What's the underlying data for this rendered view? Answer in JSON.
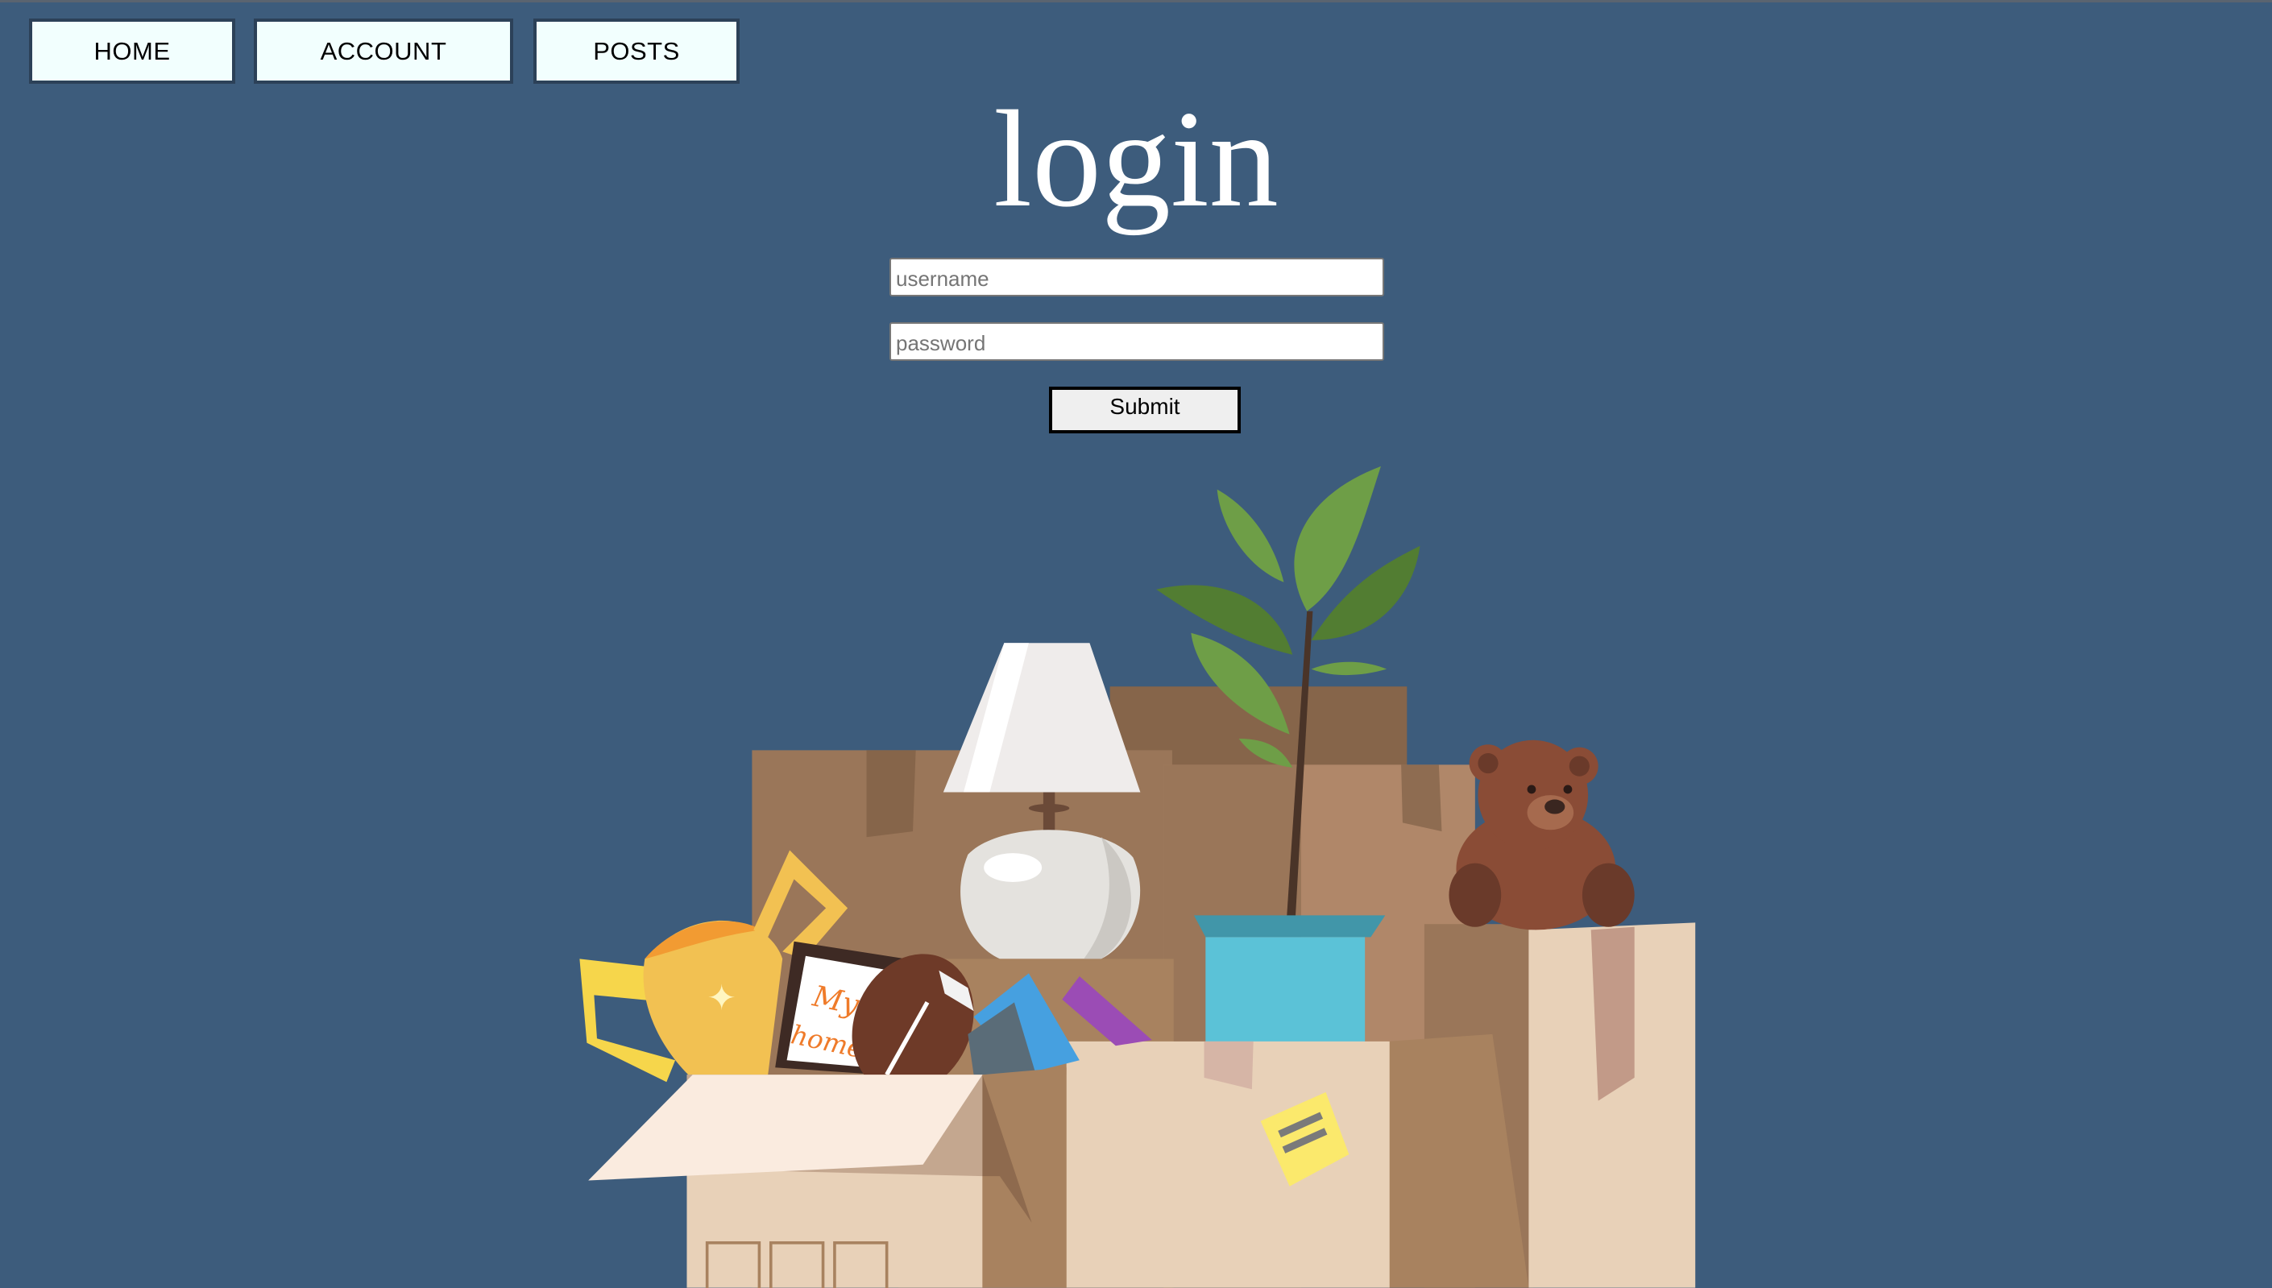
{
  "nav": {
    "home_label": "HOME",
    "account_label": "ACCOUNT",
    "posts_label": "POSTS"
  },
  "login": {
    "title": "login",
    "username_placeholder": "username",
    "password_placeholder": "password",
    "submit_label": "Submit"
  },
  "illustration": {
    "frame_text_line1": "My",
    "frame_text_line2": "home"
  },
  "colors": {
    "background": "#3d5c7c",
    "nav_button_bg": "#f2fffe",
    "nav_button_border": "#2c4158",
    "submit_bg": "#efefef"
  }
}
